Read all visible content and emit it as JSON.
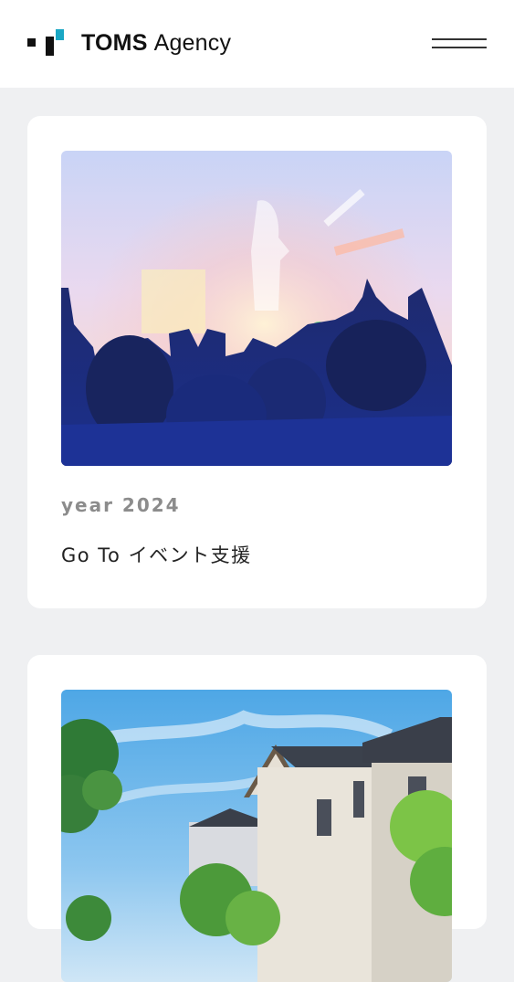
{
  "header": {
    "brand": "TOMS",
    "brand_suffix": "Agency",
    "accent_color": "#1aa7c4"
  },
  "menu": {
    "icon": "hamburger-icon"
  },
  "works": [
    {
      "year": "year 2024",
      "title": "Go To イベント支援",
      "image": "concert-crowd-photo"
    },
    {
      "image": "suburban-houses-photo"
    }
  ]
}
